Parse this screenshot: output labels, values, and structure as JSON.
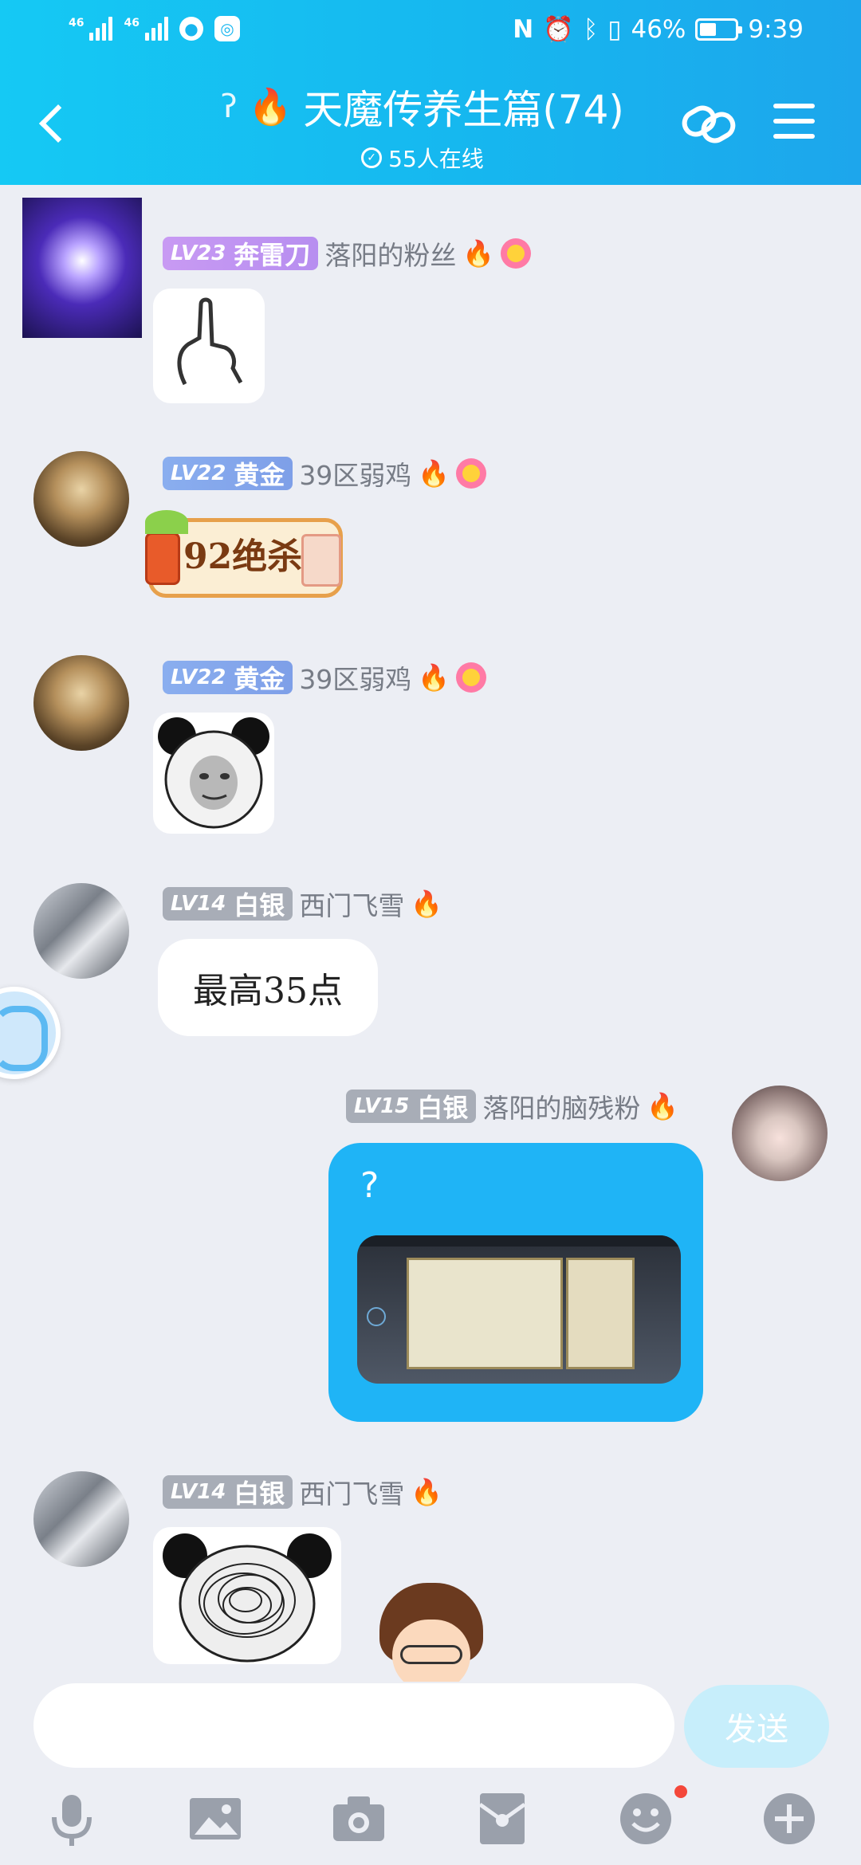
{
  "status_bar": {
    "sim1": "46",
    "sim2": "46",
    "battery": "46%",
    "time": "9:39"
  },
  "header": {
    "title": "天魔传养生篇(74)",
    "online": "55人在线"
  },
  "messages": [
    {
      "level": "LV23",
      "title": "奔雷刀",
      "name": "落阳的粉丝"
    },
    {
      "level": "LV22",
      "title": "黄金",
      "name": "39区弱鸡",
      "sticker_text": "92绝杀"
    },
    {
      "level": "LV22",
      "title": "黄金",
      "name": "39区弱鸡"
    },
    {
      "level": "LV14",
      "title": "白银",
      "name": "西门飞雪",
      "text": "最高35点"
    },
    {
      "level": "LV15",
      "title": "白银",
      "name": "落阳的脑残粉",
      "text": "?"
    },
    {
      "level": "LV14",
      "title": "白银",
      "name": "西门飞雪"
    }
  ],
  "composer": {
    "placeholder": "",
    "send_label": "发送"
  },
  "toolbar": [
    "mic-icon",
    "image-icon",
    "camera-icon",
    "red-packet-icon",
    "emoji-icon",
    "plus-icon"
  ],
  "colors": {
    "header": "#16b7ef",
    "bubble_out": "#1fb4f6",
    "background": "#eceef4"
  }
}
